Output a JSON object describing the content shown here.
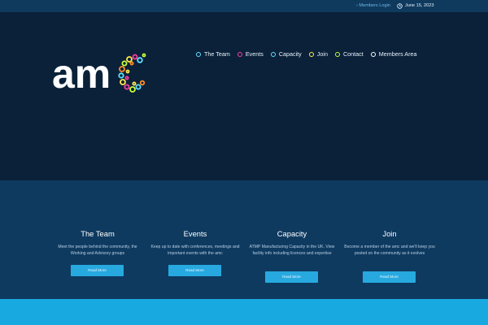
{
  "topbar": {
    "members_login": "› Members Login",
    "date": "June 15, 2023"
  },
  "nav": {
    "items": [
      {
        "label": "The Team",
        "color": "#5ee2ff"
      },
      {
        "label": "Events",
        "color": "#ff3ea5"
      },
      {
        "label": "Capacity",
        "color": "#5ee2ff"
      },
      {
        "label": "Join",
        "color": "#ffe94a"
      },
      {
        "label": "Contact",
        "color": "#c6ff39"
      },
      {
        "label": "Members Area",
        "color": "#ffffff"
      }
    ]
  },
  "logo": {
    "text": "am"
  },
  "features": [
    {
      "title": "The Team",
      "desc": "Meet the people behind the community, the Working and Advisory groups",
      "button": "Read More"
    },
    {
      "title": "Events",
      "desc": "Keep up to date with conferences, meetings and important events with the amc",
      "button": "Read More"
    },
    {
      "title": "Capacity",
      "desc": "ATMP Manufacturing Capacity in the UK. View facility info including licences and expertise",
      "button": "Read More"
    },
    {
      "title": "Join",
      "desc": "Become a member of the amc and we'll keep you posted on the community as it evolves",
      "button": "Read More"
    }
  ],
  "colors": {
    "header_bg": "#0b2139",
    "topbar_bg": "#0f3a5e",
    "features_bg": "#0e3a60",
    "accent": "#27a9e0",
    "footer_bar": "#18a9e0"
  }
}
